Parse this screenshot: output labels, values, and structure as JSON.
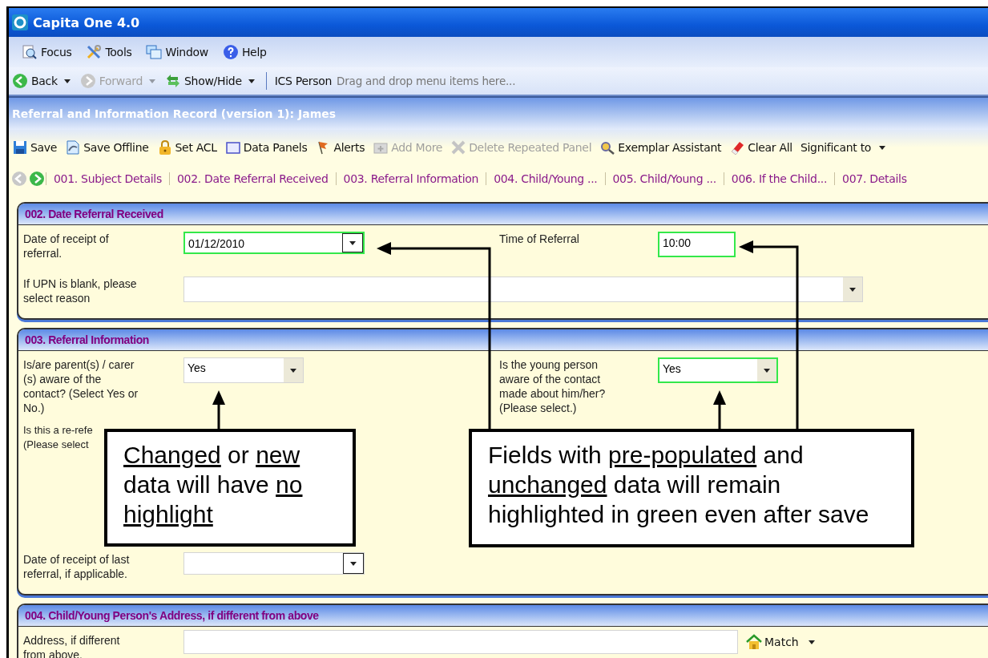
{
  "window": {
    "title": "Capita One 4.0"
  },
  "menu": [
    {
      "label": "Focus"
    },
    {
      "label": "Tools"
    },
    {
      "label": "Window"
    },
    {
      "label": "Help"
    }
  ],
  "nav_toolbar": {
    "items": [
      {
        "label": "Back",
        "disabled": false,
        "dropdown": true
      },
      {
        "label": "Forward",
        "disabled": true,
        "dropdown": true
      },
      {
        "label": "Show/Hide",
        "disabled": false,
        "dropdown": true
      }
    ],
    "person": "ICS Person",
    "hint": "Drag and drop menu items here..."
  },
  "record_title": "Referral and Information Record (version 1): James",
  "toolbar": [
    {
      "label": "Save",
      "disabled": false,
      "dropdown": false
    },
    {
      "label": "Save Offline",
      "disabled": false,
      "dropdown": false
    },
    {
      "label": "Set ACL",
      "disabled": false,
      "dropdown": false
    },
    {
      "label": "Data Panels",
      "disabled": false,
      "dropdown": false
    },
    {
      "label": "Alerts",
      "disabled": false,
      "dropdown": false
    },
    {
      "label": "Add More",
      "disabled": true,
      "dropdown": false
    },
    {
      "label": "Delete Repeated Panel",
      "disabled": true,
      "dropdown": false
    },
    {
      "label": "Exemplar Assistant",
      "disabled": false,
      "dropdown": false
    },
    {
      "label": "Clear All",
      "disabled": false,
      "dropdown": false
    },
    {
      "label": "Significant to",
      "disabled": false,
      "dropdown": true
    }
  ],
  "section_nav": {
    "previous_disabled": true,
    "next_disabled": false
  },
  "section_tabs": [
    {
      "label": "001. Subject Details",
      "selected": false
    },
    {
      "label": "002. Date Referral Received",
      "selected": false
    },
    {
      "label": "003. Referral Information",
      "selected": false
    },
    {
      "label": "004. Child/Young ...",
      "selected": false
    },
    {
      "label": "005. Child/Young ...",
      "selected": false
    },
    {
      "label": "006. If the Child...",
      "selected": false
    },
    {
      "label": "007. Details",
      "selected": false
    }
  ],
  "panels": [
    {
      "title": "002. Date Referral Received",
      "rows": [
        {
          "tall": false,
          "fields": [
            {
              "label": "Date of receipt of referral.",
              "kind": "date",
              "value": "01/12/2010",
              "highlighted": true
            },
            {
              "label": "Time of Referral",
              "kind": "time",
              "value": "10:00",
              "highlighted": true
            }
          ]
        },
        {
          "tall": false,
          "fields": [
            {
              "label": "If UPN is blank, please select reason",
              "kind": "wide-select",
              "highlighted": false
            }
          ]
        }
      ]
    },
    {
      "title": "003. Referral Information",
      "rows": [
        {
          "tall": false,
          "fields": [
            {
              "label": "Is/are parent(s) / carer (s) aware of the contact? (Select Yes or No.)",
              "kind": "select",
              "value": "Yes",
              "highlighted": false
            },
            {
              "label": "Is the young person aware of the contact made about him/her? (Please select.)",
              "kind": "select",
              "value": "Yes",
              "highlighted": true
            }
          ]
        },
        {
          "tall": true,
          "fields": [
            {
              "label": "Is this a re-refe\n(Please select",
              "kind": "covered"
            }
          ]
        },
        {
          "tall": false,
          "fields": [
            {
              "label": "Date of receipt of last referral, if applicable.",
              "kind": "date",
              "highlighted": false
            }
          ]
        }
      ]
    },
    {
      "title": "004. Child/Young Person's Address, if different from above",
      "rows": [
        {
          "tall": false,
          "fields": [
            {
              "label": "Address, if different from above.",
              "kind": "address",
              "highlighted": false,
              "action": "Match"
            }
          ]
        }
      ]
    }
  ],
  "callouts": [
    {
      "segments": [
        {
          "text": "Changed",
          "underline": true
        },
        {
          "text": " or ",
          "underline": false
        },
        {
          "text": "new",
          "underline": true
        },
        {
          "text": " data will have ",
          "underline": false
        },
        {
          "text": "no ",
          "underline": true
        },
        {
          "text": "highlight",
          "underline": true
        }
      ]
    },
    {
      "segments": [
        {
          "text": "Fields with ",
          "underline": false
        },
        {
          "text": "pre-populated",
          "underline": true
        },
        {
          "text": " and ",
          "underline": false
        },
        {
          "text": "unchanged",
          "underline": true
        },
        {
          "text": " data will remain highlighted in green even after save",
          "underline": false
        }
      ]
    }
  ]
}
